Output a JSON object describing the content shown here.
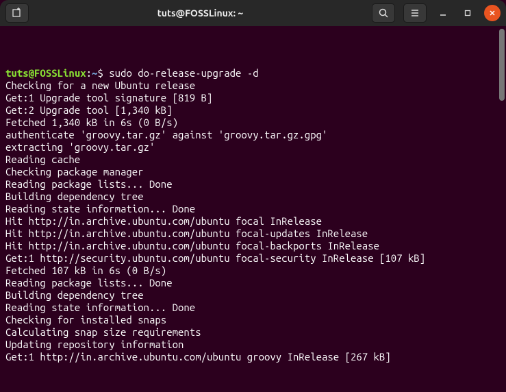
{
  "titlebar": {
    "title": "tuts@FOSSLinux: ~"
  },
  "prompt": {
    "user": "tuts",
    "at": "@",
    "host": "FOSSLinux",
    "colon": ":",
    "path": "~",
    "dollar": "$ "
  },
  "command": "sudo do-release-upgrade -d",
  "lines": [
    "Checking for a new Ubuntu release",
    "Get:1 Upgrade tool signature [819 B]",
    "Get:2 Upgrade tool [1,340 kB]",
    "Fetched 1,340 kB in 6s (0 B/s)",
    "authenticate 'groovy.tar.gz' against 'groovy.tar.gz.gpg'",
    "extracting 'groovy.tar.gz'",
    "",
    "Reading cache",
    "",
    "Checking package manager",
    "Reading package lists... Done",
    "Building dependency tree",
    "Reading state information... Done",
    "Hit http://in.archive.ubuntu.com/ubuntu focal InRelease",
    "Hit http://in.archive.ubuntu.com/ubuntu focal-updates InRelease",
    "Hit http://in.archive.ubuntu.com/ubuntu focal-backports InRelease",
    "Get:1 http://security.ubuntu.com/ubuntu focal-security InRelease [107 kB]",
    "Fetched 107 kB in 6s (0 B/s)",
    "Reading package lists... Done",
    "Building dependency tree",
    "Reading state information... Done",
    "",
    "Checking for installed snaps",
    "",
    "Calculating snap size requirements",
    "",
    "Updating repository information",
    "Get:1 http://in.archive.ubuntu.com/ubuntu groovy InRelease [267 kB]"
  ]
}
